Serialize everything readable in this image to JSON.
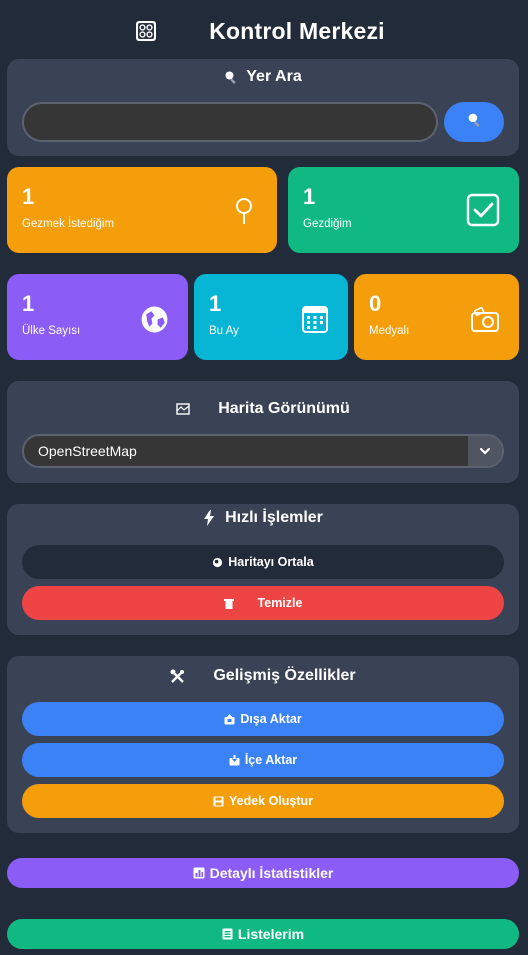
{
  "header": {
    "title": "Kontrol Merkezi",
    "icon": "control-panel-icon"
  },
  "search": {
    "title": "Yer Ara",
    "value": "",
    "placeholder": ""
  },
  "stats": [
    {
      "number": "1",
      "label": "Gezmek İstediğim",
      "icon": "pin-icon",
      "color": "#f59e0b"
    },
    {
      "number": "1",
      "label": "Gezdiğim",
      "icon": "checkbox-icon",
      "color": "#10b981"
    },
    {
      "number": "1",
      "label": "Ülke Sayısı",
      "icon": "globe-icon",
      "color": "#8b5cf6"
    },
    {
      "number": "1",
      "label": "Bu Ay",
      "icon": "calendar-icon",
      "color": "#06b6d4"
    },
    {
      "number": "0",
      "label": "Medyalı",
      "icon": "camera-icon",
      "color": "#f59e0b"
    }
  ],
  "map_view": {
    "title": "Harita Görünümü",
    "selected": "OpenStreetMap"
  },
  "quick_actions": {
    "title": "Hızlı İşlemler",
    "center_label": "Haritayı Ortala",
    "clear_label": "Temizle"
  },
  "advanced": {
    "title": "Gelişmiş Özellikler",
    "export_label": "Dışa Aktar",
    "import_label": "İçe Aktar",
    "backup_label": "Yedek Oluştur"
  },
  "bottom": {
    "stats_label": "Detaylı İstatistikler",
    "lists_label": "Listelerim"
  },
  "colors": {
    "background": "#222b3a",
    "card": "#3a4355",
    "blue": "#3b82f6",
    "red": "#ef4444",
    "orange": "#f59e0b",
    "green": "#10b981",
    "purple": "#8b5cf6",
    "cyan": "#06b6d4"
  }
}
